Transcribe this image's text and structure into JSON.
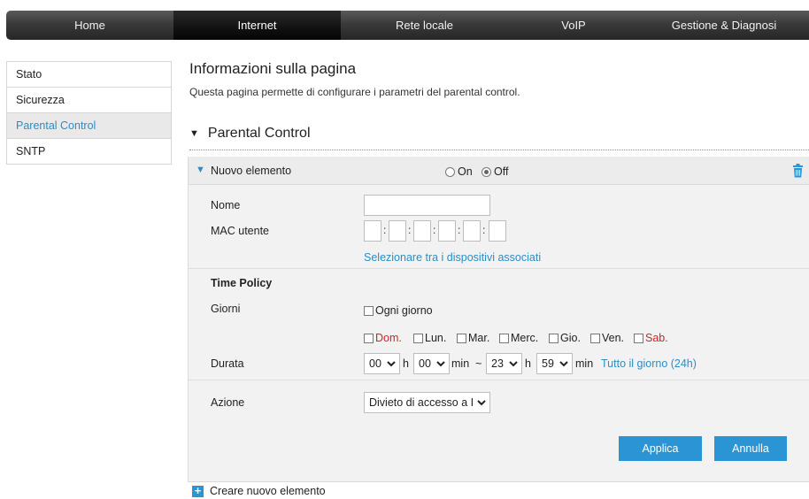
{
  "nav": {
    "items": [
      {
        "label": "Home",
        "active": false
      },
      {
        "label": "Internet",
        "active": true
      },
      {
        "label": "Rete locale",
        "active": false
      },
      {
        "label": "VoIP",
        "active": false
      },
      {
        "label": "Gestione & Diagnosi",
        "active": false
      }
    ]
  },
  "sidebar": {
    "items": [
      {
        "label": "Stato",
        "active": false
      },
      {
        "label": "Sicurezza",
        "active": false
      },
      {
        "label": "Parental Control",
        "active": true
      },
      {
        "label": "SNTP",
        "active": false
      }
    ]
  },
  "page": {
    "title": "Informazioni sulla pagina",
    "description": "Questa pagina permette di configurare i parametri del parental control.",
    "section_title": "Parental Control"
  },
  "item": {
    "header_label": "Nuovo elemento",
    "radio_on": "On",
    "radio_off": "Off",
    "selected": "Off",
    "name_label": "Nome",
    "name_value": "",
    "mac_label": "MAC utente",
    "mac_values": [
      "",
      "",
      "",
      "",
      "",
      ""
    ],
    "mac_separator": ":",
    "select_devices_link": "Selezionare tra i dispositivi associati",
    "time_policy_label": "Time Policy",
    "days_label": "Giorni",
    "every_day": "Ogni giorno",
    "days": [
      "Dom.",
      "Lun.",
      "Mar.",
      "Merc.",
      "Gio.",
      "Ven.",
      "Sab."
    ],
    "duration_label": "Durata",
    "start_hour": "00",
    "start_min": "00",
    "end_hour": "23",
    "end_min": "59",
    "unit_h": "h",
    "unit_min": "min",
    "range_sep": "~",
    "all_day_link": "Tutto il giorno (24h)",
    "action_label": "Azione",
    "action_value": "Divieto di accesso a I",
    "apply_label": "Applica",
    "cancel_label": "Annulla"
  },
  "footer": {
    "create_label": "Creare nuovo elemento"
  },
  "colors": {
    "accent": "#2b94d4",
    "link": "#2b8ec7",
    "weekend": "#c62828"
  }
}
